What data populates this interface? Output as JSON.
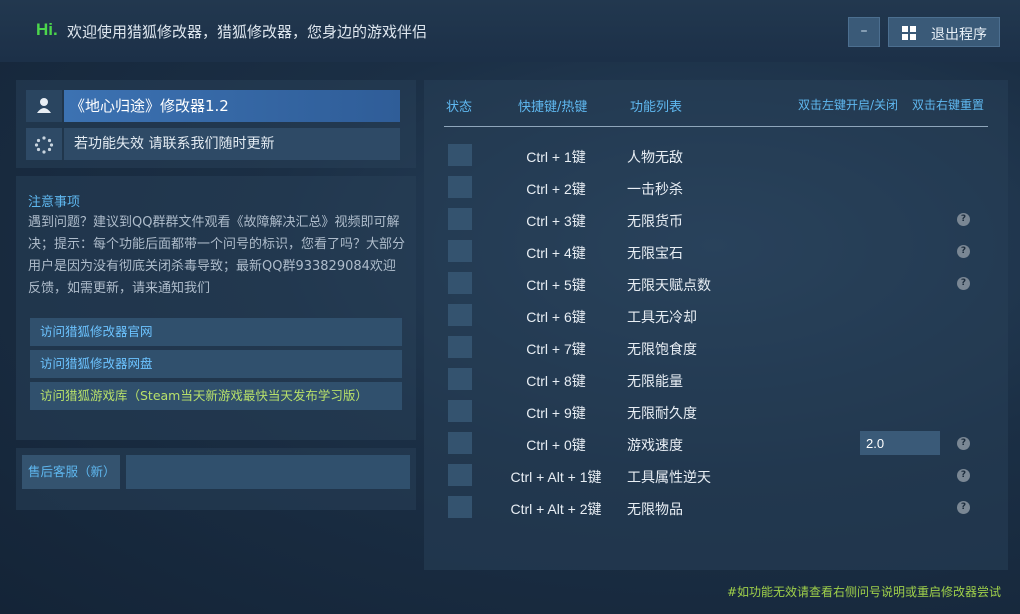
{
  "header": {
    "hi": "Hi.",
    "welcome": "欢迎使用猎狐修改器，猎狐修改器，您身边的游戏伴侣",
    "minimize_label": "–",
    "exit_label": "退出程序"
  },
  "left": {
    "title": "《地心归途》修改器1.2",
    "status": "若功能失效 请联系我们随时更新",
    "notes_title": "注意事项",
    "notes_body": "遇到问题？建议到QQ群群文件观看《故障解决汇总》视频即可解决；提示：每个功能后面都带一个问号的标识，您看了吗？大部分用户是因为没有彻底关闭杀毒导致；最新QQ群933829084欢迎反馈，如需更新，请来通知我们",
    "links": [
      {
        "label": "访问猎狐修改器官网",
        "color": "#6cc3ff"
      },
      {
        "label": "访问猎狐修改器网盘",
        "color": "#6cc3ff"
      },
      {
        "label": "访问猎狐游戏库（Steam当天新游戏最快当天发布学习版）",
        "color": "#b7e06a"
      }
    ],
    "service_label": "售后客服（新）"
  },
  "table": {
    "headers": {
      "status": "状态",
      "hotkey": "快捷键/热键",
      "features": "功能列表",
      "toggle_hint": "双击左键开启/关闭",
      "reset_hint": "双击右键重置"
    },
    "rows": [
      {
        "hotkey": "Ctrl + 1键",
        "feature": "人物无敌",
        "help": false
      },
      {
        "hotkey": "Ctrl + 2键",
        "feature": "一击秒杀",
        "help": false
      },
      {
        "hotkey": "Ctrl + 3键",
        "feature": "无限货币",
        "help": true
      },
      {
        "hotkey": "Ctrl + 4键",
        "feature": "无限宝石",
        "help": true
      },
      {
        "hotkey": "Ctrl + 5键",
        "feature": "无限天赋点数",
        "help": true
      },
      {
        "hotkey": "Ctrl + 6键",
        "feature": "工具无冷却",
        "help": false
      },
      {
        "hotkey": "Ctrl + 7键",
        "feature": "无限饱食度",
        "help": false
      },
      {
        "hotkey": "Ctrl + 8键",
        "feature": "无限能量",
        "help": false
      },
      {
        "hotkey": "Ctrl + 9键",
        "feature": "无限耐久度",
        "help": false
      },
      {
        "hotkey": "Ctrl + 0键",
        "feature": "游戏速度",
        "help": true,
        "input_value": "2.0"
      },
      {
        "hotkey": "Ctrl + Alt + 1键",
        "feature": "工具属性逆天",
        "help": true
      },
      {
        "hotkey": "Ctrl + Alt + 2键",
        "feature": "无限物品",
        "help": true
      }
    ],
    "help_glyph": "?"
  },
  "footer": "#如功能无效请查看右侧问号说明或重启修改器尝试"
}
